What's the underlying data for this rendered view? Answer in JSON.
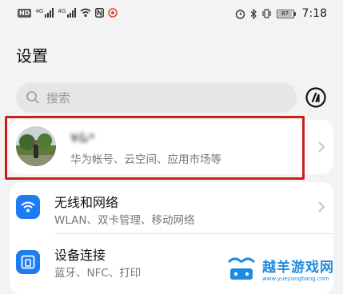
{
  "status_bar": {
    "hd": "HD",
    "network1": "4G",
    "network2": "4G",
    "battery": "87",
    "time": "7:18"
  },
  "page": {
    "title": "设置"
  },
  "search": {
    "placeholder": "搜索"
  },
  "account": {
    "name": "¥&*",
    "subtitle": "华为帐号、云空间、应用市场等"
  },
  "settings_items": [
    {
      "title": "无线和网络",
      "subtitle": "WLAN、双卡管理、移动网络",
      "icon": "wifi-icon"
    },
    {
      "title": "设备连接",
      "subtitle": "蓝牙、NFC、打印",
      "icon": "device-connection-icon"
    }
  ],
  "watermark": {
    "title": "越羊游戏网",
    "url": "www.yueyangbang.com"
  },
  "colors": {
    "accent": "#1e7cf2",
    "highlight": "#c8201c",
    "background": "#f3f3f3"
  }
}
